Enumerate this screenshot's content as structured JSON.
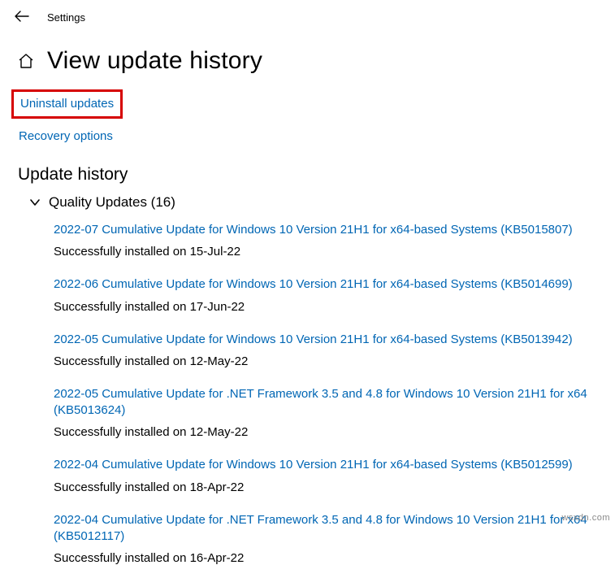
{
  "app": {
    "title": "Settings"
  },
  "page": {
    "title": "View update history"
  },
  "links": {
    "uninstall": "Uninstall updates",
    "recovery": "Recovery options"
  },
  "history": {
    "heading": "Update history",
    "group_label": "Quality Updates (16)",
    "items": [
      {
        "title": "2022-07 Cumulative Update for Windows 10 Version 21H1 for x64-based Systems (KB5015807)",
        "status": "Successfully installed on 15-Jul-22"
      },
      {
        "title": "2022-06 Cumulative Update for Windows 10 Version 21H1 for x64-based Systems (KB5014699)",
        "status": "Successfully installed on 17-Jun-22"
      },
      {
        "title": "2022-05 Cumulative Update for Windows 10 Version 21H1 for x64-based Systems (KB5013942)",
        "status": "Successfully installed on 12-May-22"
      },
      {
        "title": "2022-05 Cumulative Update for .NET Framework 3.5 and 4.8 for Windows 10 Version 21H1 for x64 (KB5013624)",
        "status": "Successfully installed on 12-May-22"
      },
      {
        "title": "2022-04 Cumulative Update for Windows 10 Version 21H1 for x64-based Systems (KB5012599)",
        "status": "Successfully installed on 18-Apr-22"
      },
      {
        "title": "2022-04 Cumulative Update for .NET Framework 3.5 and 4.8 for Windows 10 Version 21H1 for x64 (KB5012117)",
        "status": "Successfully installed on 16-Apr-22"
      }
    ]
  },
  "watermark": "wsxdn.com"
}
